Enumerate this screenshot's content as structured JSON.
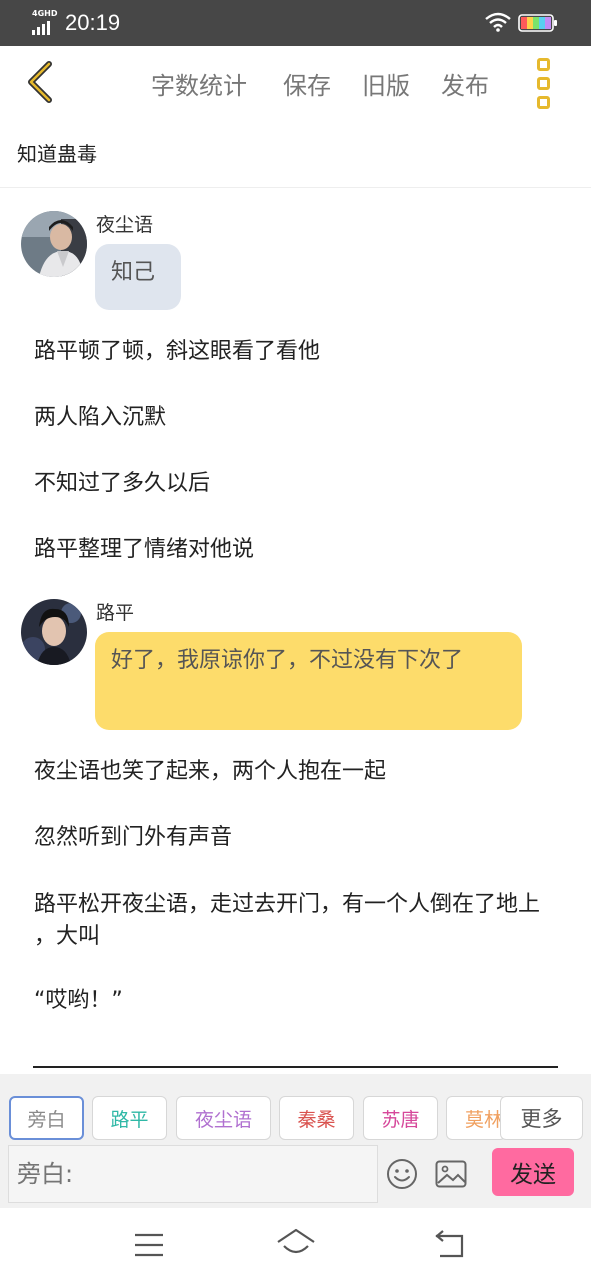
{
  "status_bar": {
    "network": "4GHD",
    "time": "20:19",
    "battery": "89"
  },
  "topbar": {
    "actions": [
      "字数统计",
      "保存",
      "旧版",
      "发布"
    ]
  },
  "document": {
    "title": "知道蛊毒"
  },
  "messages": [
    {
      "type": "dialog",
      "speaker": "夜尘语",
      "text": "知己",
      "bubble_color": "#dfe5ee"
    },
    {
      "type": "narration",
      "text": "路平顿了顿，斜这眼看了看他"
    },
    {
      "type": "narration",
      "text": "两人陷入沉默"
    },
    {
      "type": "narration",
      "text": "不知过了多久以后"
    },
    {
      "type": "narration",
      "text": "路平整理了情绪对他说"
    },
    {
      "type": "dialog",
      "speaker": "路平",
      "text": "好了，我原谅你了，不过没有下次了",
      "bubble_color": "#fddc6b"
    },
    {
      "type": "narration",
      "text": "夜尘语也笑了起来，两个人抱在一起"
    },
    {
      "type": "narration",
      "text": "忽然听到门外有声音"
    },
    {
      "type": "narration",
      "text": "路平松开夜尘语，走过去开门，有一个人倒在了地上 ，大叫"
    },
    {
      "type": "narration",
      "text": "“哎哟！”"
    }
  ],
  "editor": {
    "characters": [
      {
        "name": "旁白",
        "color": "#8a8a8a"
      },
      {
        "name": "路平",
        "color": "#2fb8a6"
      },
      {
        "name": "夜尘语",
        "color": "#b070d0"
      },
      {
        "name": "秦桑",
        "color": "#d9534f"
      },
      {
        "name": "苏唐",
        "color": "#d6479a"
      },
      {
        "name": "莫林",
        "color": "#f0a060"
      }
    ],
    "more_label": "更多",
    "input_placeholder": "旁白:",
    "send_label": "发送",
    "accent_color": "#ff6aa0"
  },
  "icons": {
    "back": "chevron-left-icon",
    "more": "vertical-dots-icon",
    "emoji": "smiley-icon",
    "image": "image-icon",
    "nav_menu": "menu-icon",
    "nav_home": "home-icon",
    "nav_back": "back-arrow-icon"
  }
}
